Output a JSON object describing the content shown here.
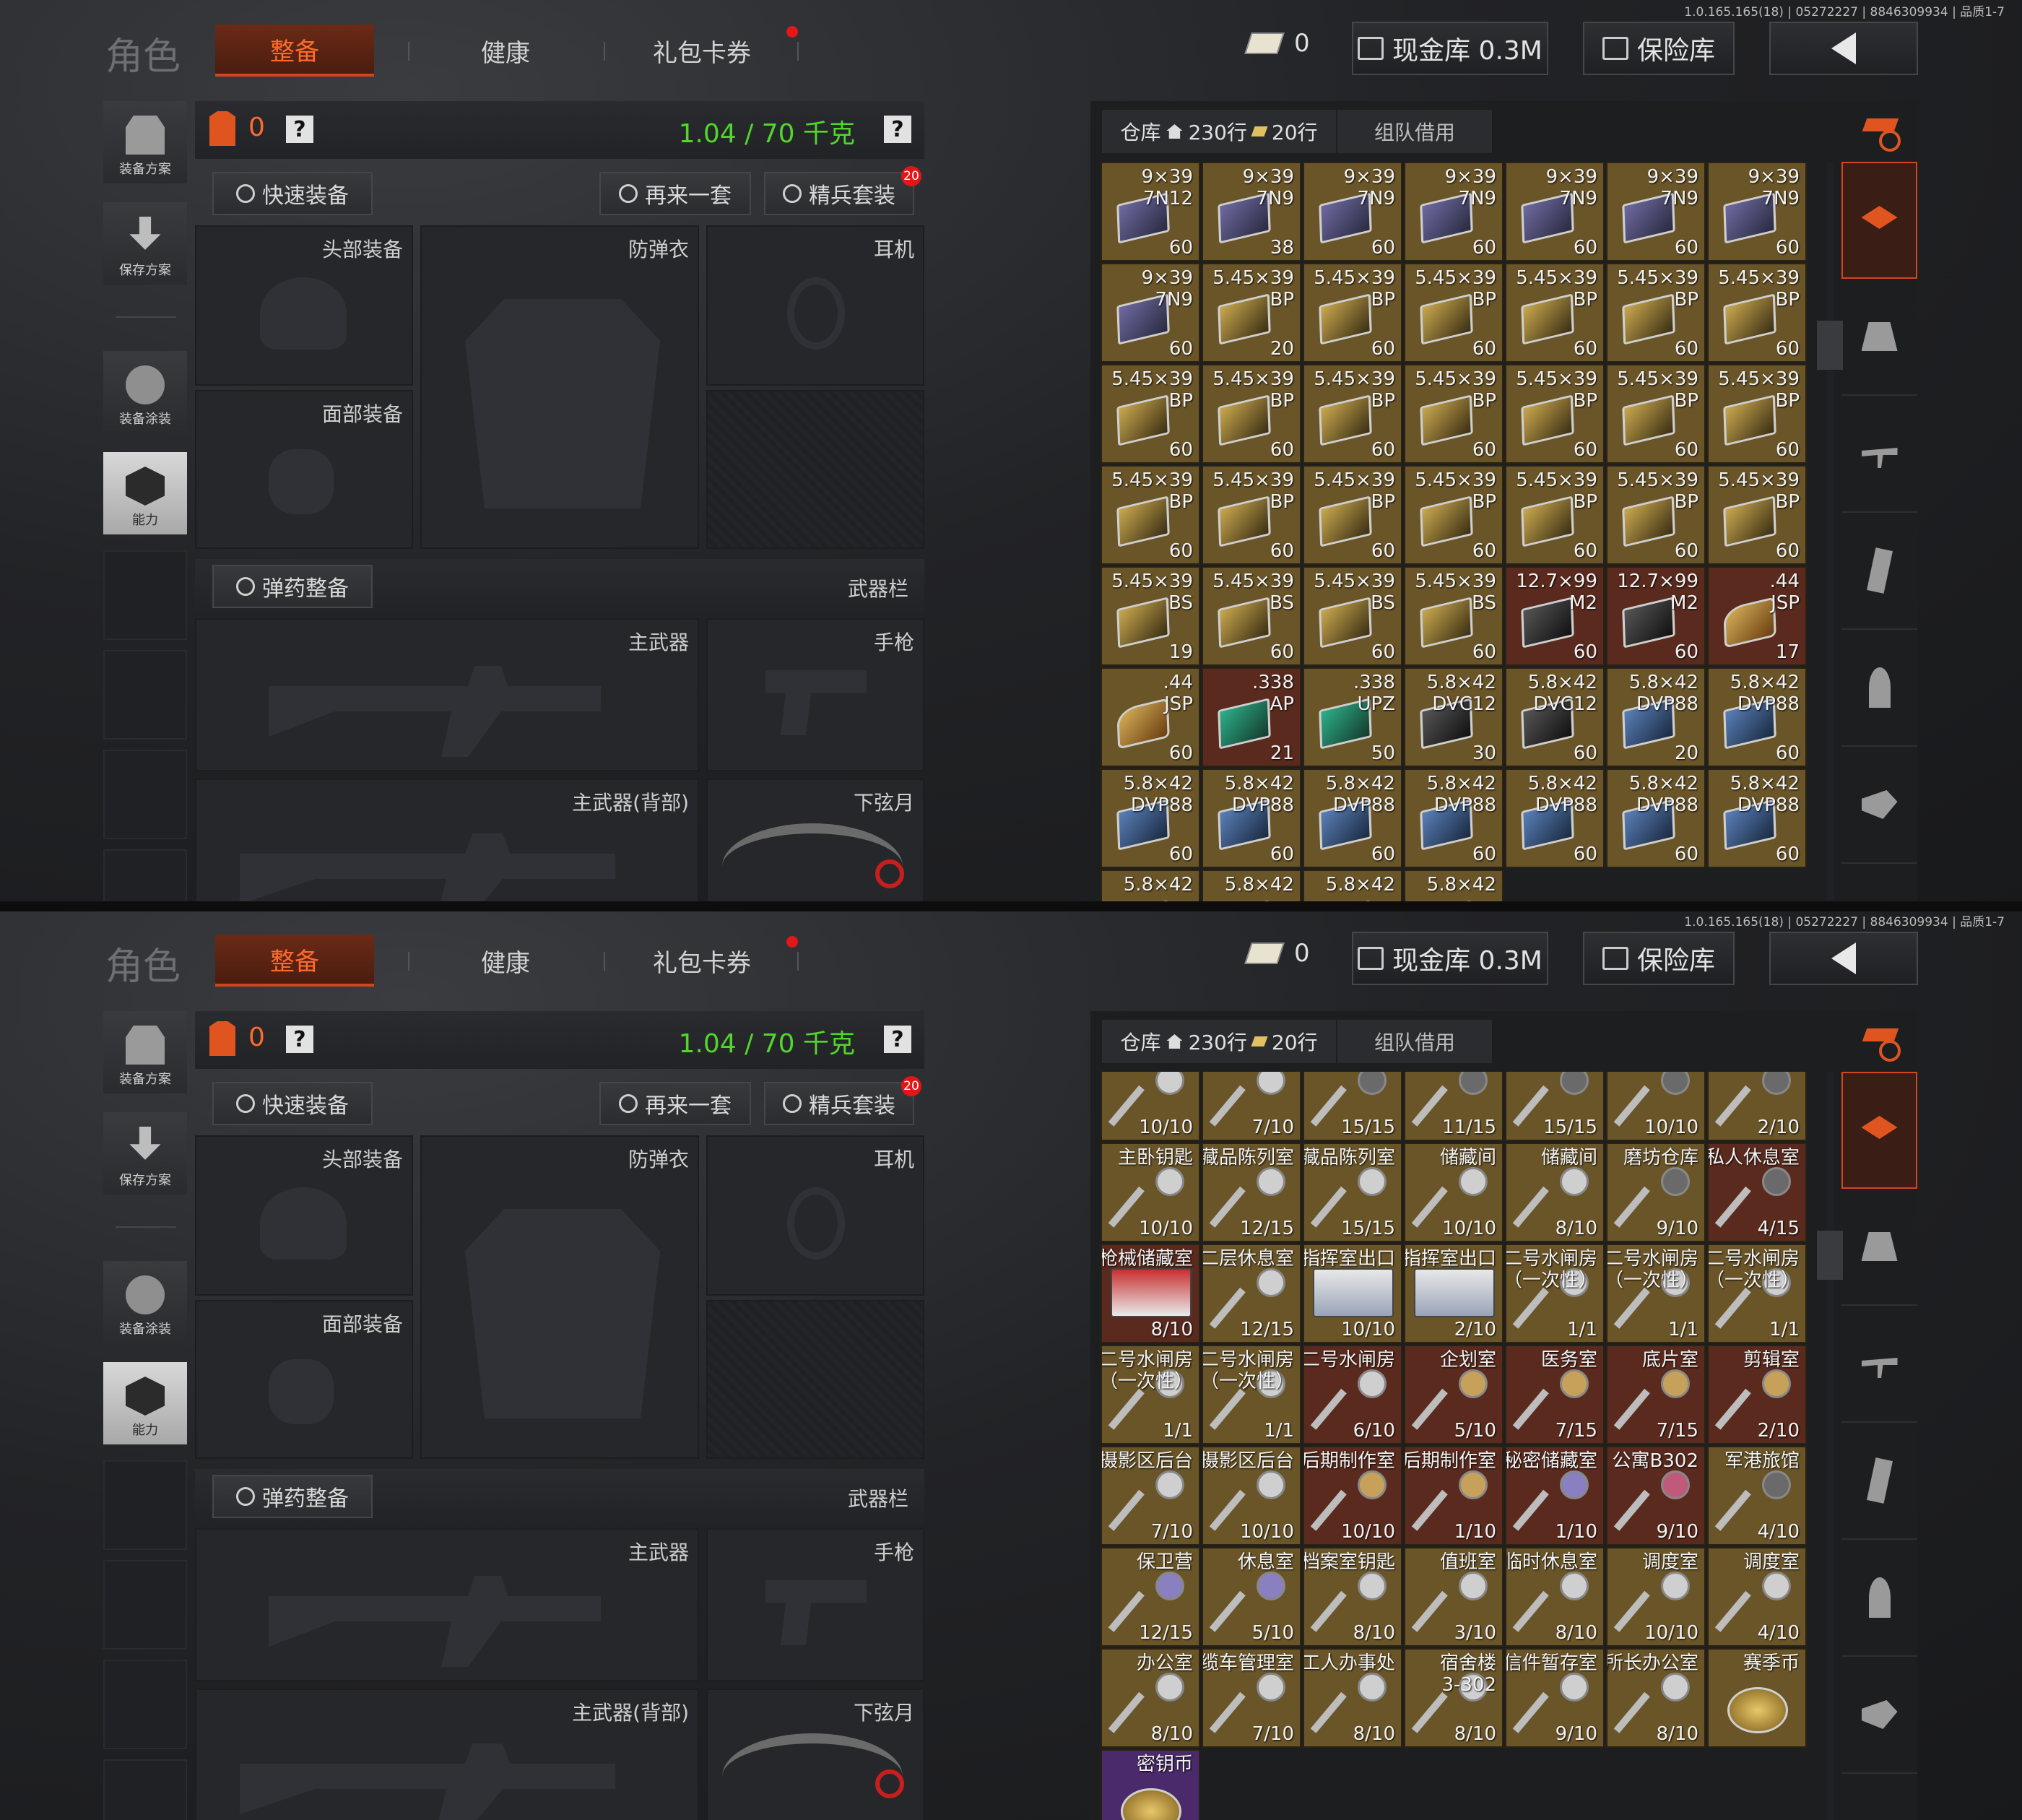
{
  "version": "1.0.165.165(18) | 05272227 | 8846309934 | 品质1-7",
  "header": {
    "title": "角色",
    "tabs": [
      "整备",
      "健康",
      "礼包卡券"
    ],
    "coupon_count": "0",
    "cash_btn": "现金库 0.3M",
    "safe_btn": "保险库",
    "accent": "#e0551f",
    "back_icon": "back-arrow-icon"
  },
  "left_nav": {
    "loadout": "装备方案",
    "save": "保存方案",
    "paint": "装备涂装",
    "ability": "能力"
  },
  "equip": {
    "armor_count": "0",
    "help": "?",
    "weight": "1.04 / 70 千克",
    "quick_equip": "快速装备",
    "again": "再来一套",
    "elite": "精兵套装",
    "elite_badge": "20",
    "slots": {
      "head": "头部装备",
      "vest": "防弹衣",
      "ear": "耳机",
      "face": "面部装备",
      "ammo": "弹药整备",
      "weapon_bar": "武器栏",
      "primary": "主武器",
      "pistol": "手枪",
      "primary_back": "主武器(背部)",
      "melee": "下弦月"
    }
  },
  "storage": {
    "tab_label": "仓库",
    "rows": "230行",
    "rows2": "20行",
    "team_tab": "组队借用"
  },
  "ammo_grid": [
    {
      "t": "9×39\n7N12",
      "c": "60",
      "k": "purple"
    },
    {
      "t": "9×39\n7N9",
      "c": "38",
      "k": "purple"
    },
    {
      "t": "9×39\n7N9",
      "c": "60",
      "k": "purple"
    },
    {
      "t": "9×39\n7N9",
      "c": "60",
      "k": "purple"
    },
    {
      "t": "9×39\n7N9",
      "c": "60",
      "k": "purple"
    },
    {
      "t": "9×39\n7N9",
      "c": "60",
      "k": "purple"
    },
    {
      "t": "9×39\n7N9",
      "c": "60",
      "k": "purple"
    },
    {
      "t": "9×39\n7N9",
      "c": "60",
      "k": "purple"
    },
    {
      "t": "5.45×39\nBP",
      "c": "20",
      "k": "gold"
    },
    {
      "t": "5.45×39\nBP",
      "c": "60",
      "k": "gold"
    },
    {
      "t": "5.45×39\nBP",
      "c": "60",
      "k": "gold"
    },
    {
      "t": "5.45×39\nBP",
      "c": "60",
      "k": "gold"
    },
    {
      "t": "5.45×39\nBP",
      "c": "60",
      "k": "gold"
    },
    {
      "t": "5.45×39\nBP",
      "c": "60",
      "k": "gold"
    },
    {
      "t": "5.45×39\nBP",
      "c": "60",
      "k": "gold"
    },
    {
      "t": "5.45×39\nBP",
      "c": "60",
      "k": "gold"
    },
    {
      "t": "5.45×39\nBP",
      "c": "60",
      "k": "gold"
    },
    {
      "t": "5.45×39\nBP",
      "c": "60",
      "k": "gold"
    },
    {
      "t": "5.45×39\nBP",
      "c": "60",
      "k": "gold"
    },
    {
      "t": "5.45×39\nBP",
      "c": "60",
      "k": "gold"
    },
    {
      "t": "5.45×39\nBP",
      "c": "60",
      "k": "gold"
    },
    {
      "t": "5.45×39\nBP",
      "c": "60",
      "k": "gold"
    },
    {
      "t": "5.45×39\nBP",
      "c": "60",
      "k": "gold"
    },
    {
      "t": "5.45×39\nBP",
      "c": "60",
      "k": "gold"
    },
    {
      "t": "5.45×39\nBP",
      "c": "60",
      "k": "gold"
    },
    {
      "t": "5.45×39\nBP",
      "c": "60",
      "k": "gold"
    },
    {
      "t": "5.45×39\nBP",
      "c": "60",
      "k": "gold"
    },
    {
      "t": "5.45×39\nBP",
      "c": "60",
      "k": "gold"
    },
    {
      "t": "5.45×39\nBS",
      "c": "19",
      "k": "gold"
    },
    {
      "t": "5.45×39\nBS",
      "c": "60",
      "k": "gold"
    },
    {
      "t": "5.45×39\nBS",
      "c": "60",
      "k": "gold"
    },
    {
      "t": "5.45×39\nBS",
      "c": "60",
      "k": "gold"
    },
    {
      "t": "12.7×99\nM2",
      "c": "60",
      "k": "black",
      "bg": "red"
    },
    {
      "t": "12.7×99\nM2",
      "c": "60",
      "k": "black",
      "bg": "red"
    },
    {
      "t": ".44\nJSP",
      "c": "17",
      "k": "ammo",
      "bg": "red"
    },
    {
      "t": ".44\nJSP",
      "c": "60",
      "k": "ammo"
    },
    {
      "t": ".338\nAP",
      "c": "21",
      "k": "green",
      "bg": "red"
    },
    {
      "t": ".338\nUPZ",
      "c": "50",
      "k": "green"
    },
    {
      "t": "5.8×42\nDVC12",
      "c": "30",
      "k": "black"
    },
    {
      "t": "5.8×42\nDVC12",
      "c": "60",
      "k": "black"
    },
    {
      "t": "5.8×42\nDVP88",
      "c": "20",
      "k": "blue"
    },
    {
      "t": "5.8×42\nDVP88",
      "c": "60",
      "k": "blue"
    },
    {
      "t": "5.8×42\nDVP88",
      "c": "60",
      "k": "blue"
    },
    {
      "t": "5.8×42\nDVP88",
      "c": "60",
      "k": "blue"
    },
    {
      "t": "5.8×42\nDVP88",
      "c": "60",
      "k": "blue"
    },
    {
      "t": "5.8×42\nDVP88",
      "c": "60",
      "k": "blue"
    },
    {
      "t": "5.8×42\nDVP88",
      "c": "60",
      "k": "blue"
    },
    {
      "t": "5.8×42\nDVP88",
      "c": "60",
      "k": "blue"
    },
    {
      "t": "5.8×42\nDVP88",
      "c": "60",
      "k": "blue"
    },
    {
      "t": "5.8×42",
      "c": "",
      "k": "blue"
    },
    {
      "t": "5.8×42",
      "c": "",
      "k": "blue"
    },
    {
      "t": "5.8×42",
      "c": "",
      "k": "blue"
    },
    {
      "t": "5.8×42",
      "c": "",
      "k": "blue"
    }
  ],
  "key_grid": [
    {
      "t": "",
      "c": "10/10",
      "k": "silver"
    },
    {
      "t": "",
      "c": "7/10",
      "k": "silver"
    },
    {
      "t": "",
      "c": "15/15",
      "k": "dark"
    },
    {
      "t": "",
      "c": "11/15",
      "k": "dark"
    },
    {
      "t": "",
      "c": "15/15",
      "k": "dark"
    },
    {
      "t": "",
      "c": "10/10",
      "k": "dark"
    },
    {
      "t": "",
      "c": "2/10",
      "k": "dark"
    },
    {
      "t": "主卧钥匙",
      "c": "10/10",
      "k": "silver"
    },
    {
      "t": "藏品陈列室",
      "c": "12/15",
      "k": "silver"
    },
    {
      "t": "藏品陈列室",
      "c": "15/15",
      "k": "silver"
    },
    {
      "t": "储藏间",
      "c": "10/10",
      "k": "silver"
    },
    {
      "t": "储藏间",
      "c": "8/10",
      "k": "silver"
    },
    {
      "t": "磨坊仓库",
      "c": "9/10",
      "k": "dark"
    },
    {
      "t": "私人休息室",
      "c": "4/15",
      "k": "dark",
      "bg": "red"
    },
    {
      "t": "枪械储藏室",
      "c": "8/10",
      "k": "card-red",
      "bg": "red"
    },
    {
      "t": "二层休息室",
      "c": "12/15",
      "k": "silver"
    },
    {
      "t": "指挥室出口",
      "c": "10/10",
      "k": "card"
    },
    {
      "t": "指挥室出口",
      "c": "2/10",
      "k": "card"
    },
    {
      "t": "二号水闸房\n（一次性）",
      "c": "1/1",
      "k": "silver"
    },
    {
      "t": "二号水闸房\n（一次性）",
      "c": "1/1",
      "k": "silver"
    },
    {
      "t": "二号水闸房\n（一次性）",
      "c": "1/1",
      "k": "silver"
    },
    {
      "t": "二号水闸房\n（一次性）",
      "c": "1/1",
      "k": "silver"
    },
    {
      "t": "二号水闸房\n（一次性）",
      "c": "1/1",
      "k": "silver"
    },
    {
      "t": "二号水闸房",
      "c": "6/10",
      "k": "silver",
      "bg": "red"
    },
    {
      "t": "企划室",
      "c": "5/10",
      "k": "gold",
      "bg": "red"
    },
    {
      "t": "医务室",
      "c": "7/15",
      "k": "gold",
      "bg": "red"
    },
    {
      "t": "底片室",
      "c": "7/15",
      "k": "gold",
      "bg": "red"
    },
    {
      "t": "剪辑室",
      "c": "2/10",
      "k": "gold",
      "bg": "red"
    },
    {
      "t": "摄影区后台",
      "c": "7/10",
      "k": "silver"
    },
    {
      "t": "摄影区后台",
      "c": "10/10",
      "k": "silver"
    },
    {
      "t": "后期制作室",
      "c": "10/10",
      "k": "gold",
      "bg": "red"
    },
    {
      "t": "后期制作室",
      "c": "1/10",
      "k": "gold",
      "bg": "red"
    },
    {
      "t": "秘密储藏室",
      "c": "1/10",
      "k": "purple",
      "bg": "red"
    },
    {
      "t": "公寓B302",
      "c": "9/10",
      "k": "pink",
      "bg": "red"
    },
    {
      "t": "军港旅馆",
      "c": "4/10",
      "k": "dark"
    },
    {
      "t": "保卫营",
      "c": "12/15",
      "k": "purple"
    },
    {
      "t": "休息室",
      "c": "5/10",
      "k": "purple"
    },
    {
      "t": "档案室钥匙",
      "c": "8/10",
      "k": "silver"
    },
    {
      "t": "值班室",
      "c": "3/10",
      "k": "silver"
    },
    {
      "t": "临时休息室",
      "c": "8/10",
      "k": "silver"
    },
    {
      "t": "调度室",
      "c": "10/10",
      "k": "silver"
    },
    {
      "t": "调度室",
      "c": "4/10",
      "k": "silver"
    },
    {
      "t": "办公室",
      "c": "8/10",
      "k": "silver"
    },
    {
      "t": "缆车管理室",
      "c": "7/10",
      "k": "silver"
    },
    {
      "t": "工人办事处",
      "c": "8/10",
      "k": "silver"
    },
    {
      "t": "宿舍楼\n3-302",
      "c": "8/10",
      "k": "silver"
    },
    {
      "t": "信件暂存室",
      "c": "9/10",
      "k": "silver"
    },
    {
      "t": "所长办公室",
      "c": "8/10",
      "k": "silver"
    },
    {
      "t": "赛季币",
      "c": "",
      "k": "coin",
      "skip": 1
    },
    {
      "t": "密钥币",
      "c": "",
      "k": "coin",
      "bg": "purple"
    }
  ]
}
